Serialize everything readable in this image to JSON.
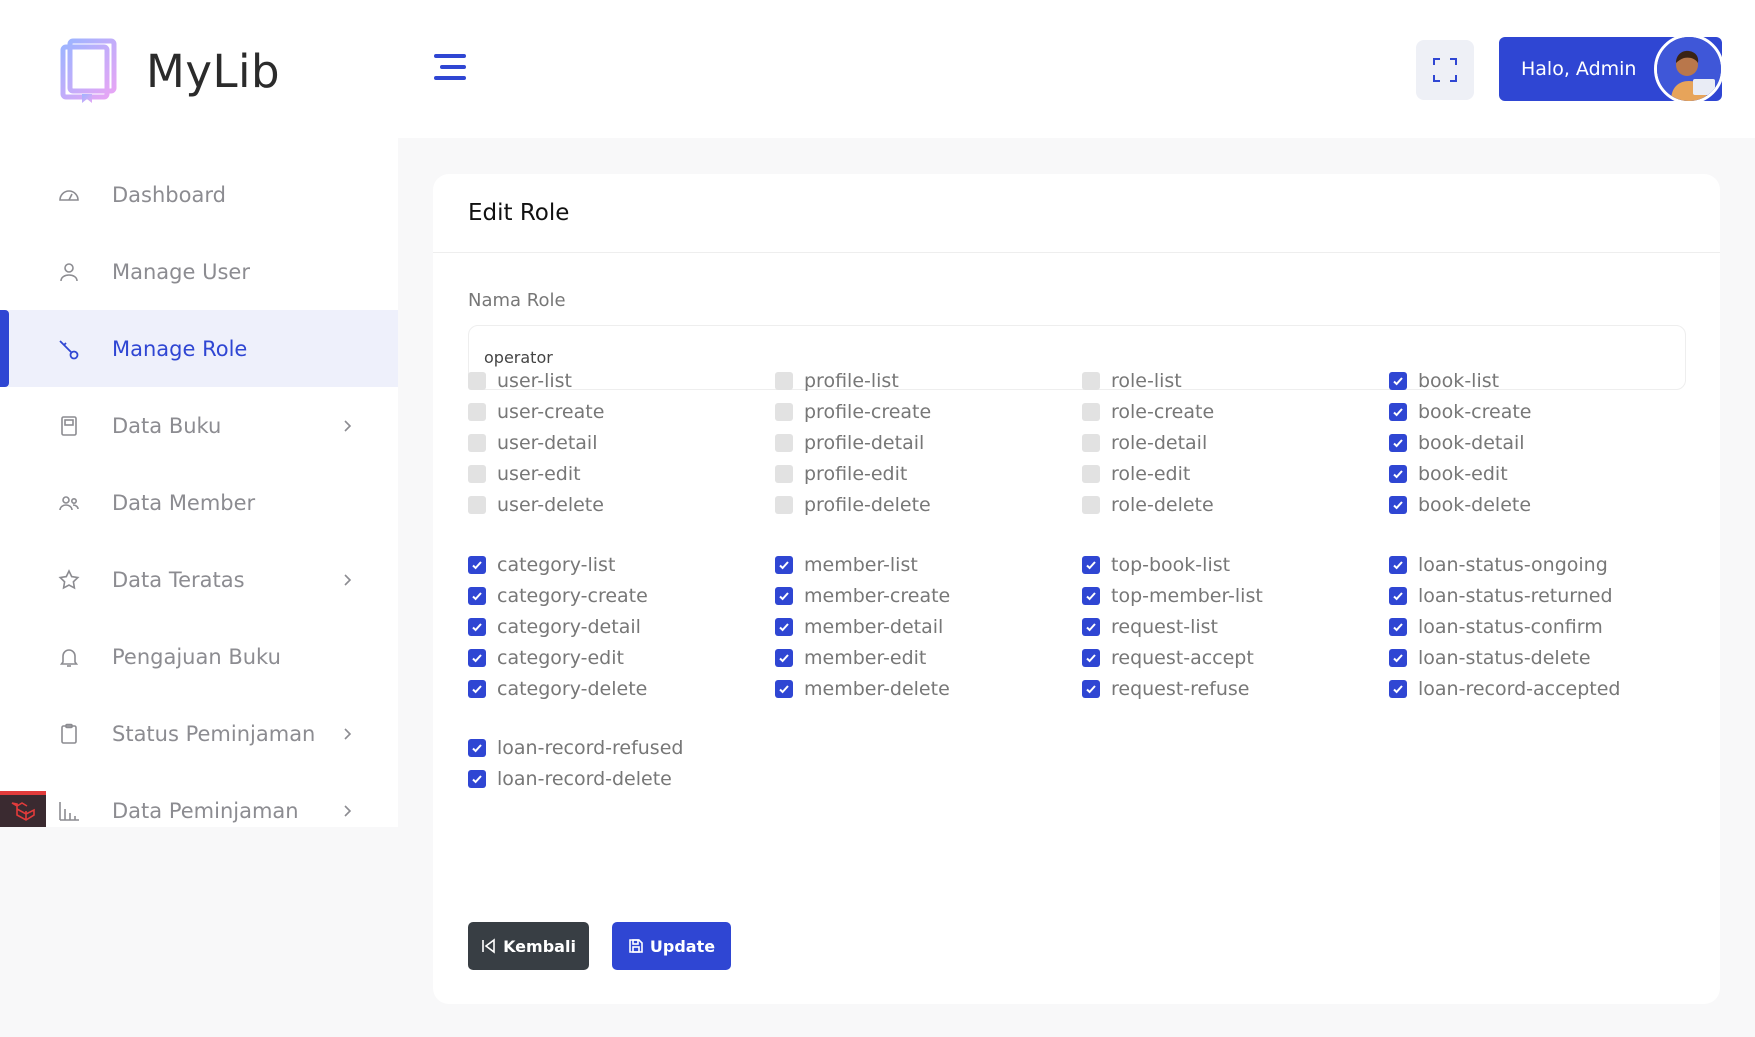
{
  "brand": {
    "name": "MyLib"
  },
  "sidebar": {
    "items": [
      {
        "label": "Dashboard",
        "icon": "gauge-icon",
        "chevron": false,
        "active": false
      },
      {
        "label": "Manage User",
        "icon": "user-icon",
        "chevron": false,
        "active": false
      },
      {
        "label": "Manage Role",
        "icon": "key-icon",
        "chevron": false,
        "active": true
      },
      {
        "label": "Data Buku",
        "icon": "book-icon",
        "chevron": true,
        "active": false
      },
      {
        "label": "Data Member",
        "icon": "users-icon",
        "chevron": false,
        "active": false
      },
      {
        "label": "Data Teratas",
        "icon": "star-icon",
        "chevron": true,
        "active": false
      },
      {
        "label": "Pengajuan Buku",
        "icon": "bell-icon",
        "chevron": false,
        "active": false
      },
      {
        "label": "Status Peminjaman",
        "icon": "clipboard-icon",
        "chevron": true,
        "active": false
      },
      {
        "label": "Data Peminjaman",
        "icon": "bar-chart-icon",
        "chevron": true,
        "active": false
      }
    ]
  },
  "header": {
    "greeting": "Halo, Admin"
  },
  "form": {
    "title": "Edit Role",
    "name_label": "Nama Role",
    "name_value": "operator",
    "permissions": [
      [
        {
          "label": "user-list",
          "checked": false
        },
        {
          "label": "user-create",
          "checked": false
        },
        {
          "label": "user-detail",
          "checked": false
        },
        {
          "label": "user-edit",
          "checked": false
        },
        {
          "label": "user-delete",
          "checked": false
        },
        {
          "label": "category-list",
          "checked": true
        },
        {
          "label": "category-create",
          "checked": true
        },
        {
          "label": "category-detail",
          "checked": true
        },
        {
          "label": "category-edit",
          "checked": true
        },
        {
          "label": "category-delete",
          "checked": true
        },
        {
          "label": "loan-record-refused",
          "checked": true
        },
        {
          "label": "loan-record-delete",
          "checked": true
        }
      ],
      [
        {
          "label": "profile-list",
          "checked": false
        },
        {
          "label": "profile-create",
          "checked": false
        },
        {
          "label": "profile-detail",
          "checked": false
        },
        {
          "label": "profile-edit",
          "checked": false
        },
        {
          "label": "profile-delete",
          "checked": false
        },
        {
          "label": "member-list",
          "checked": true
        },
        {
          "label": "member-create",
          "checked": true
        },
        {
          "label": "member-detail",
          "checked": true
        },
        {
          "label": "member-edit",
          "checked": true
        },
        {
          "label": "member-delete",
          "checked": true
        }
      ],
      [
        {
          "label": "role-list",
          "checked": false
        },
        {
          "label": "role-create",
          "checked": false
        },
        {
          "label": "role-detail",
          "checked": false
        },
        {
          "label": "role-edit",
          "checked": false
        },
        {
          "label": "role-delete",
          "checked": false
        },
        {
          "label": "top-book-list",
          "checked": true
        },
        {
          "label": "top-member-list",
          "checked": true
        },
        {
          "label": "request-list",
          "checked": true
        },
        {
          "label": "request-accept",
          "checked": true
        },
        {
          "label": "request-refuse",
          "checked": true
        }
      ],
      [
        {
          "label": "book-list",
          "checked": true
        },
        {
          "label": "book-create",
          "checked": true
        },
        {
          "label": "book-detail",
          "checked": true
        },
        {
          "label": "book-edit",
          "checked": true
        },
        {
          "label": "book-delete",
          "checked": true
        },
        {
          "label": "loan-status-ongoing",
          "checked": true
        },
        {
          "label": "loan-status-returned",
          "checked": true
        },
        {
          "label": "loan-status-confirm",
          "checked": true
        },
        {
          "label": "loan-status-delete",
          "checked": true
        },
        {
          "label": "loan-record-accepted",
          "checked": true
        }
      ]
    ],
    "back_label": "Kembali",
    "update_label": "Update"
  },
  "colors": {
    "accent": "#2f46d3",
    "back_button": "#383e44",
    "active_bg": "#eef0fb"
  }
}
